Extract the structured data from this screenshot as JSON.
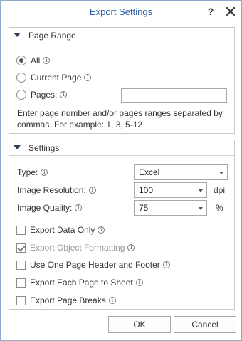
{
  "dialog": {
    "title": "Export Settings",
    "help_label": "?"
  },
  "page_range": {
    "header": "Page Range",
    "options": [
      {
        "label": "All",
        "checked": true
      },
      {
        "label": "Current Page",
        "checked": false
      },
      {
        "label": "Pages:",
        "checked": false
      }
    ],
    "pages_input_value": "",
    "description": "Enter page number and/or pages ranges separated by commas. For example: 1, 3, 5-12"
  },
  "settings": {
    "header": "Settings",
    "type_label": "Type:",
    "type_value": "Excel",
    "resolution_label": "Image Resolution:",
    "resolution_value": "100",
    "resolution_unit": "dpi",
    "quality_label": "Image Quality:",
    "quality_value": "75",
    "quality_unit": "%",
    "checkboxes": [
      {
        "label": "Export Data Only",
        "checked": false,
        "disabled": false
      },
      {
        "label": "Export Object Formatting",
        "checked": true,
        "disabled": true
      },
      {
        "label": "Use One Page Header and Footer",
        "checked": false,
        "disabled": false
      },
      {
        "label": "Export Each Page to Sheet",
        "checked": false,
        "disabled": false
      },
      {
        "label": "Export Page Breaks",
        "checked": false,
        "disabled": false
      }
    ]
  },
  "buttons": {
    "ok": "OK",
    "cancel": "Cancel"
  },
  "icons": {
    "info": "info-icon",
    "close": "close-icon",
    "collapse": "collapse-triangle-icon",
    "dropdown": "dropdown-caret-icon"
  },
  "colors": {
    "title": "#2e5fa6",
    "border": "#8fa9cc"
  }
}
